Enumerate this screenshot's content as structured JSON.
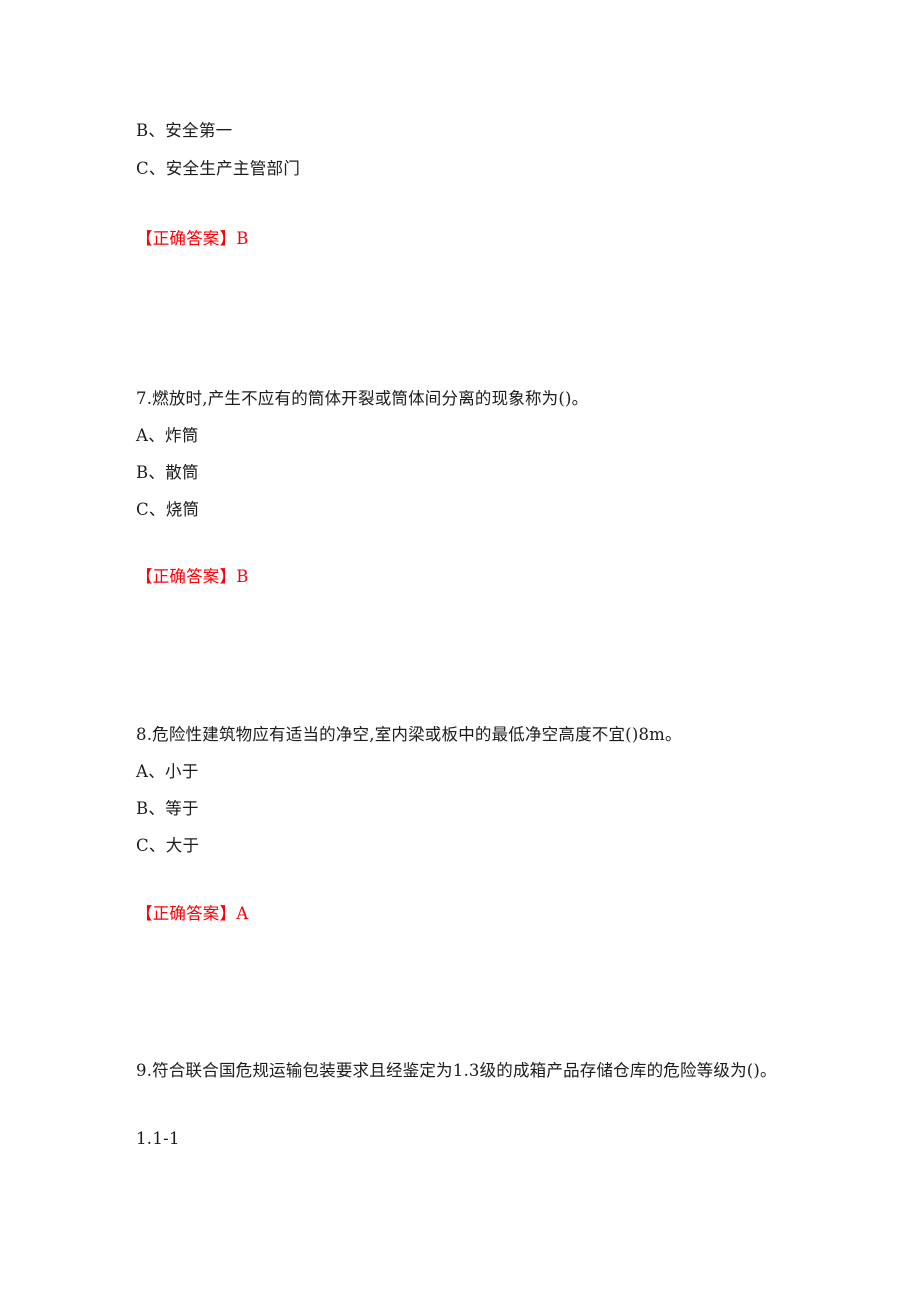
{
  "document": {
    "type": "exam-question-sheet",
    "language": "zh-CN",
    "answer_color": "#fb0007",
    "text_color": "#1c1c1c",
    "background_color": "#ffffff"
  },
  "previous_question_tail": {
    "options": [
      "B、安全第一",
      "C、安全生产主管部门"
    ],
    "answer_label": "【正确答案】",
    "answer_value": "B"
  },
  "questions": [
    {
      "number": "7.",
      "stem": "7.燃放时,产生不应有的筒体开裂或筒体间分离的现象称为()。",
      "options": [
        "A、炸筒",
        "B、散筒",
        "C、烧筒"
      ],
      "answer_label": "【正确答案】",
      "answer_value": "B"
    },
    {
      "number": "8.",
      "stem": "8.危险性建筑物应有适当的净空,室内梁或板中的最低净空高度不宜()8m。",
      "options": [
        "A、小于",
        "B、等于",
        "C、大于"
      ],
      "answer_label": "【正确答案】",
      "answer_value": "A"
    },
    {
      "number": "9.",
      "stem": "9.符合联合国危规运输包装要求且经鉴定为1.3级的成箱产品存储仓库的危险等级为()。",
      "options": [
        "1.1-1"
      ],
      "answer_label": "",
      "answer_value": ""
    }
  ]
}
